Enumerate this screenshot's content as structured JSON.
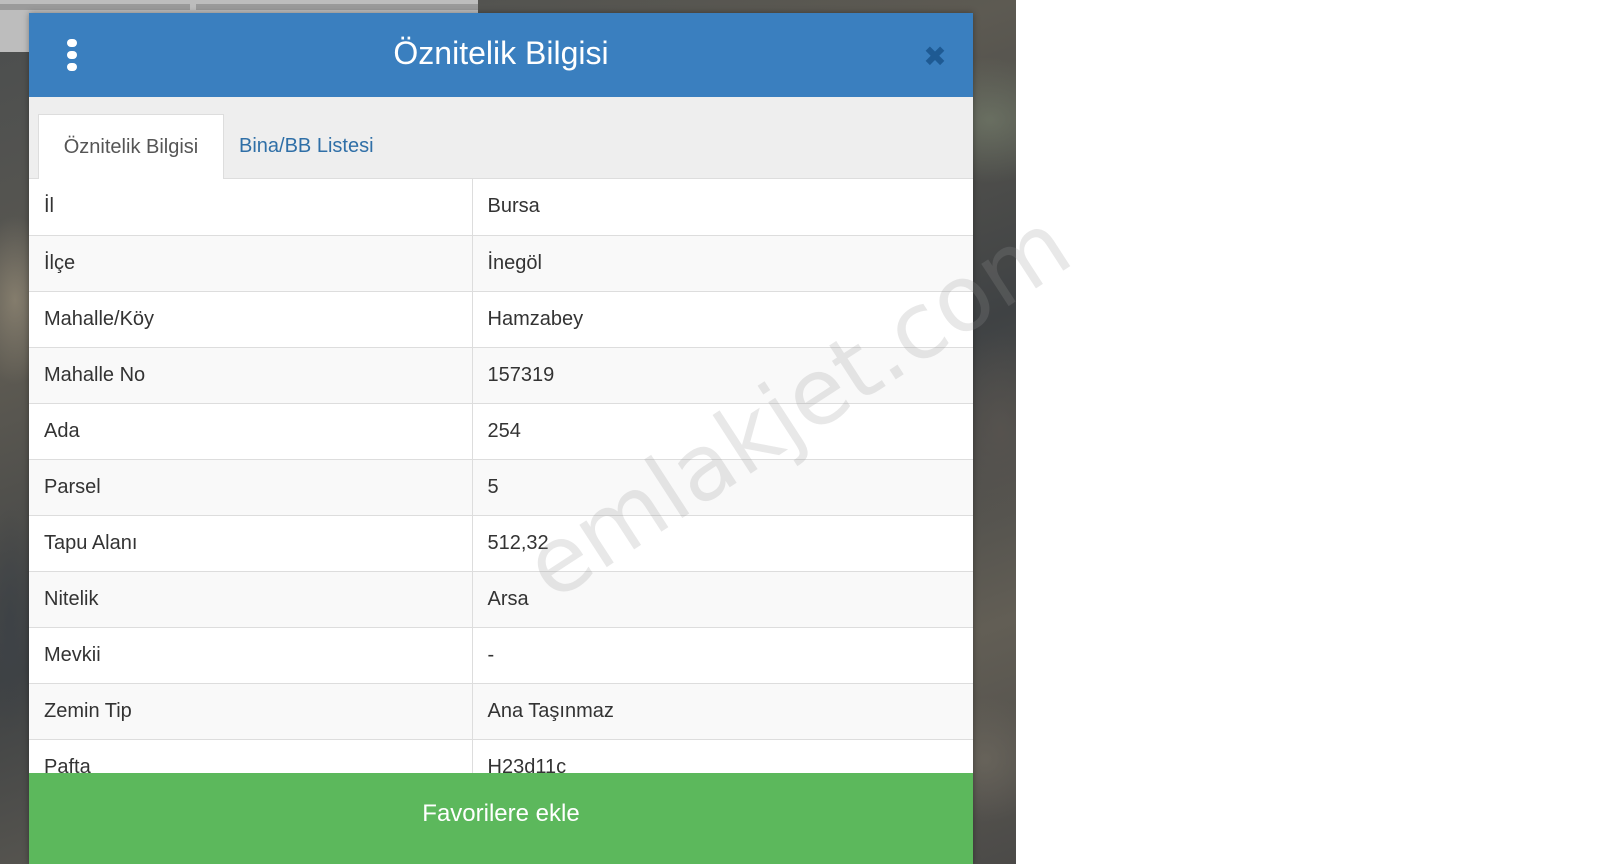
{
  "dialog": {
    "title": "Öznitelik Bilgisi",
    "close_symbol": "✖",
    "menu_icon": "vertical-ellipsis-icon",
    "header_color": "#3a7fbf"
  },
  "tabs": [
    {
      "label": "Öznitelik Bilgisi",
      "active": true
    },
    {
      "label": "Bina/BB Listesi",
      "active": false
    }
  ],
  "attributes": [
    {
      "label": "İl",
      "value": "Bursa"
    },
    {
      "label": "İlçe",
      "value": "İnegöl"
    },
    {
      "label": "Mahalle/Köy",
      "value": "Hamzabey"
    },
    {
      "label": "Mahalle No",
      "value": "157319"
    },
    {
      "label": "Ada",
      "value": "254"
    },
    {
      "label": "Parsel",
      "value": "5"
    },
    {
      "label": "Tapu Alanı",
      "value": "512,32"
    },
    {
      "label": "Nitelik",
      "value": "Arsa"
    },
    {
      "label": "Mevkii",
      "value": "-"
    },
    {
      "label": "Zemin Tip",
      "value": "Ana Taşınmaz"
    },
    {
      "label": "Pafta",
      "value": "H23d11c"
    }
  ],
  "footer": {
    "favorite_label": "Favorilere ekle",
    "button_color": "#5cb85c"
  },
  "watermark": "emlakjet.com"
}
